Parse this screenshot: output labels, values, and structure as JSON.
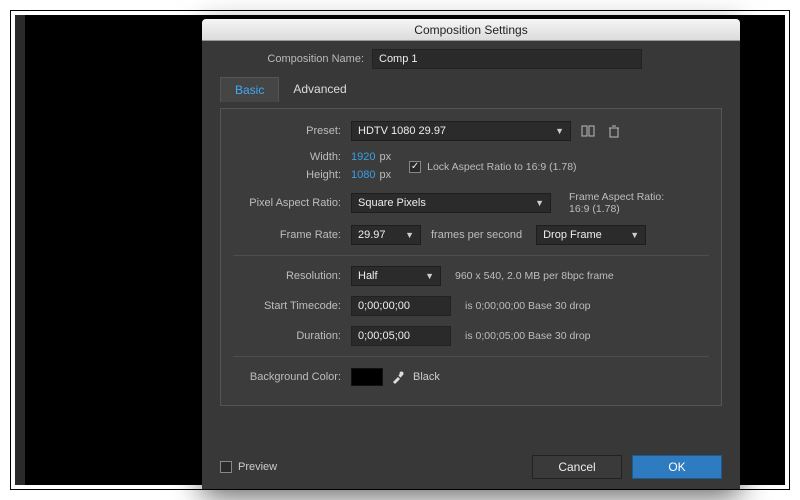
{
  "dialog": {
    "title": "Composition Settings",
    "name_label": "Composition Name:",
    "name_value": "Comp 1",
    "tabs": {
      "basic": "Basic",
      "advanced": "Advanced"
    },
    "preset": {
      "label": "Preset:",
      "value": "HDTV 1080 29.97"
    },
    "width": {
      "label": "Width:",
      "value": "1920",
      "unit": "px"
    },
    "height": {
      "label": "Height:",
      "value": "1080",
      "unit": "px"
    },
    "lock_aspect": "Lock Aspect Ratio to 16:9 (1.78)",
    "par": {
      "label": "Pixel Aspect Ratio:",
      "value": "Square Pixels"
    },
    "far": {
      "label": "Frame Aspect Ratio:",
      "value": "16:9 (1.78)"
    },
    "fps": {
      "label": "Frame Rate:",
      "value": "29.97",
      "unit": "frames per second",
      "drop": "Drop Frame"
    },
    "resolution": {
      "label": "Resolution:",
      "value": "Half",
      "info": "960 x 540, 2.0 MB per 8bpc frame"
    },
    "start_tc": {
      "label": "Start Timecode:",
      "value": "0;00;00;00",
      "info": "is 0;00;00;00 Base 30  drop"
    },
    "duration": {
      "label": "Duration:",
      "value": "0;00;05;00",
      "info": "is 0;00;05;00 Base 30  drop"
    },
    "bgcolor": {
      "label": "Background Color:",
      "name": "Black",
      "hex": "#000000"
    },
    "footer": {
      "preview": "Preview",
      "cancel": "Cancel",
      "ok": "OK"
    }
  }
}
